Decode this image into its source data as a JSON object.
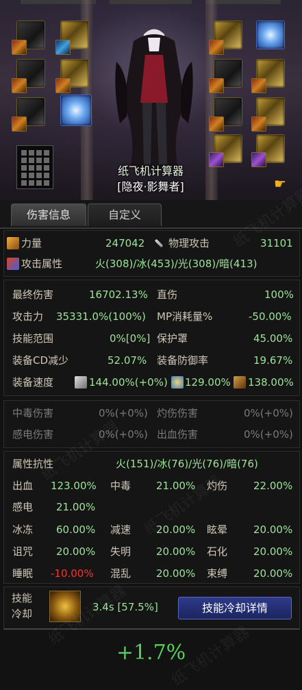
{
  "character": {
    "name": "纸飞机计算器",
    "class_title": "[隐夜·影舞者]"
  },
  "tabs": [
    {
      "label": "伤害信息",
      "active": true
    },
    {
      "label": "自定义",
      "active": false
    }
  ],
  "base_stats": {
    "strength_label": "力量",
    "strength_value": "247042",
    "phys_attack_label": "物理攻击",
    "phys_attack_value": "31101",
    "element_label": "攻击属性",
    "element_value": "火(308)/冰(453)/光(308)/暗(413)"
  },
  "damage_stats": {
    "final_damage_label": "最终伤害",
    "final_damage_value": "16702.13%",
    "direct_damage_label": "直伤",
    "direct_damage_value": "100%",
    "attack_power_label": "攻击力",
    "attack_power_value": "35331.0%(100%)",
    "mp_cost_label": "MP消耗量%",
    "mp_cost_value": "-50.00%",
    "skill_range_label": "技能范围",
    "skill_range_value": "0%[0%]",
    "shield_label": "保护罩",
    "shield_value": "45.00%",
    "cd_reduce_label": "装备CD减少",
    "cd_reduce_value": "52.07%",
    "defense_rate_label": "装备防御率",
    "defense_rate_value": "19.67%",
    "speed_label": "装备速度",
    "speed_attack_value": "144.00%(+0%)",
    "speed_cast_value": "129.00%",
    "speed_move_value": "138.00%"
  },
  "status_damage": {
    "poison_label": "中毒伤害",
    "poison_value": "0%(+0%)",
    "burn_label": "灼伤伤害",
    "burn_value": "0%(+0%)",
    "shock_label": "感电伤害",
    "shock_value": "0%(+0%)",
    "bleed_label": "出血伤害",
    "bleed_value": "0%(+0%)"
  },
  "resistance": {
    "element_res_label": "属性抗性",
    "element_res_value": "火(151)/冰(76)/光(76)/暗(76)",
    "rows": [
      [
        {
          "label": "出血",
          "value": "123.00%"
        },
        {
          "label": "中毒",
          "value": "21.00%"
        },
        {
          "label": "灼伤",
          "value": "22.00%"
        }
      ],
      [
        {
          "label": "感电",
          "value": "21.00%"
        }
      ],
      [
        {
          "label": "冰冻",
          "value": "60.00%"
        },
        {
          "label": "减速",
          "value": "20.00%"
        },
        {
          "label": "眩晕",
          "value": "20.00%"
        }
      ],
      [
        {
          "label": "诅咒",
          "value": "20.00%"
        },
        {
          "label": "失明",
          "value": "20.00%"
        },
        {
          "label": "石化",
          "value": "20.00%"
        }
      ],
      [
        {
          "label": "睡眠",
          "value": "-10.00%"
        },
        {
          "label": "混乱",
          "value": "20.00%"
        },
        {
          "label": "束缚",
          "value": "20.00%"
        }
      ]
    ]
  },
  "skill_cooldown": {
    "label_line1": "技能",
    "label_line2": "冷却",
    "value": "3.4s [57.5%]",
    "detail_button": "技能冷却详情"
  },
  "total": "+1.7%",
  "watermark": "纸飞机计算器",
  "colors": {
    "green_value": "#9ee49a",
    "negative_value": "#ff3030",
    "total_green": "#56d05a",
    "button_blue": "#1b2560"
  }
}
